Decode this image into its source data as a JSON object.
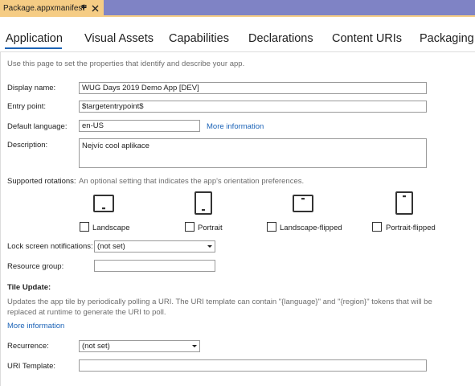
{
  "document_tab": {
    "title": "Package.appxmanifest",
    "pin_glyph": "⊕",
    "close_glyph": "✕"
  },
  "nav_tabs": [
    {
      "label": "Application",
      "active": true
    },
    {
      "label": "Visual Assets"
    },
    {
      "label": "Capabilities"
    },
    {
      "label": "Declarations"
    },
    {
      "label": "Content URIs"
    },
    {
      "label": "Packaging"
    }
  ],
  "intro": "Use this page to set the properties that identify and describe your app.",
  "fields": {
    "display_name": {
      "label": "Display name:",
      "value": "WUG Days 2019 Demo App [DEV]"
    },
    "entry_point": {
      "label": "Entry point:",
      "value": "$targetentrypoint$"
    },
    "default_language": {
      "label": "Default language:",
      "value": "en-US",
      "link": "More information"
    },
    "description": {
      "label": "Description:",
      "value": "Nejvíc cool aplikace"
    }
  },
  "rotations": {
    "label": "Supported rotations:",
    "hint": "An optional setting that indicates the app's orientation preferences.",
    "options": [
      {
        "label": "Landscape",
        "icon": "landscape-device-icon",
        "checked": false
      },
      {
        "label": "Portrait",
        "icon": "portrait-device-icon",
        "checked": false
      },
      {
        "label": "Landscape-flipped",
        "icon": "landscape-flipped-device-icon",
        "checked": false
      },
      {
        "label": "Portrait-flipped",
        "icon": "portrait-flipped-device-icon",
        "checked": false
      }
    ]
  },
  "lock_screen": {
    "label": "Lock screen notifications:",
    "value": "(not set)"
  },
  "resource_group": {
    "label": "Resource group:",
    "value": ""
  },
  "tile_update": {
    "heading": "Tile Update:",
    "description_line1": "Updates the app tile by periodically polling a URI. The URI template can contain \"{language}\" and \"{region}\" tokens that will be",
    "description_line2": "replaced at runtime to generate the URI to poll.",
    "link": "More information",
    "recurrence": {
      "label": "Recurrence:",
      "value": "(not set)"
    },
    "uri_template": {
      "label": "URI Template:",
      "value": ""
    }
  },
  "colors": {
    "title_bar": "#7f83c5",
    "document_tab": "#f5cc84",
    "accent": "#1c63b5",
    "link": "#1a62b7"
  }
}
